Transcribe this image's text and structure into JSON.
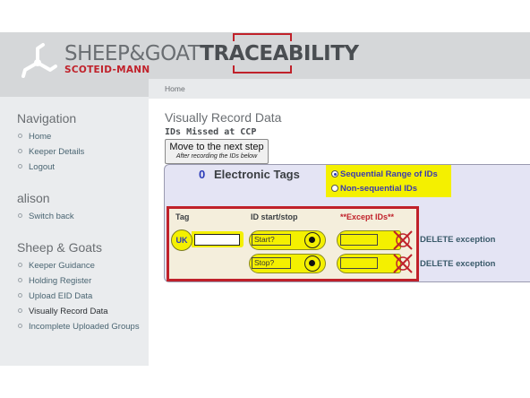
{
  "header": {
    "brand_light": "SHEEP&GOAT",
    "brand_bold": "TRACEABILITY",
    "brand_sub": "SCOTEID-MANN",
    "logo_icon": "triskelion-icon",
    "accent_color": "#c0212a"
  },
  "breadcrumb": {
    "home": "Home"
  },
  "sidebar": {
    "navigation_heading": "Navigation",
    "navigation_items": [
      {
        "label": "Home"
      },
      {
        "label": "Keeper Details"
      },
      {
        "label": "Logout"
      }
    ],
    "user_heading": "alison",
    "user_items": [
      {
        "label": "Switch back"
      }
    ],
    "sheep_heading": "Sheep & Goats",
    "sheep_items": [
      {
        "label": "Keeper Guidance"
      },
      {
        "label": "Holding Register"
      },
      {
        "label": "Upload EID Data"
      },
      {
        "label": "Visually Record Data",
        "active": true
      },
      {
        "label": "Incomplete Uploaded Groups"
      }
    ]
  },
  "main": {
    "page_title": "Visually Record Data",
    "section_subtitle": "IDs Missed at CCP",
    "next_step_button": "Move to the next step",
    "next_step_hint": "After recording the IDs below",
    "tags_count": "0",
    "tags_heading": "Electronic Tags",
    "mode_options": [
      {
        "label": "Sequential Range of IDs",
        "selected": true
      },
      {
        "label": "Non-sequential IDs",
        "selected": false
      }
    ],
    "columns": {
      "tag": "Tag",
      "id_start_stop": "ID start/stop",
      "except_ids": "**Except IDs**"
    },
    "country_code": "UK",
    "tag_value": "",
    "start_placeholder": "Start?",
    "stop_placeholder": "Stop?",
    "except_rows": [
      {
        "value": "",
        "delete_label": "DELETE exception"
      },
      {
        "value": "",
        "delete_label": "DELETE exception"
      }
    ],
    "colors": {
      "highlight": "#f4f000",
      "panel": "#e4e4f4",
      "count": "#2a3ab8"
    }
  }
}
